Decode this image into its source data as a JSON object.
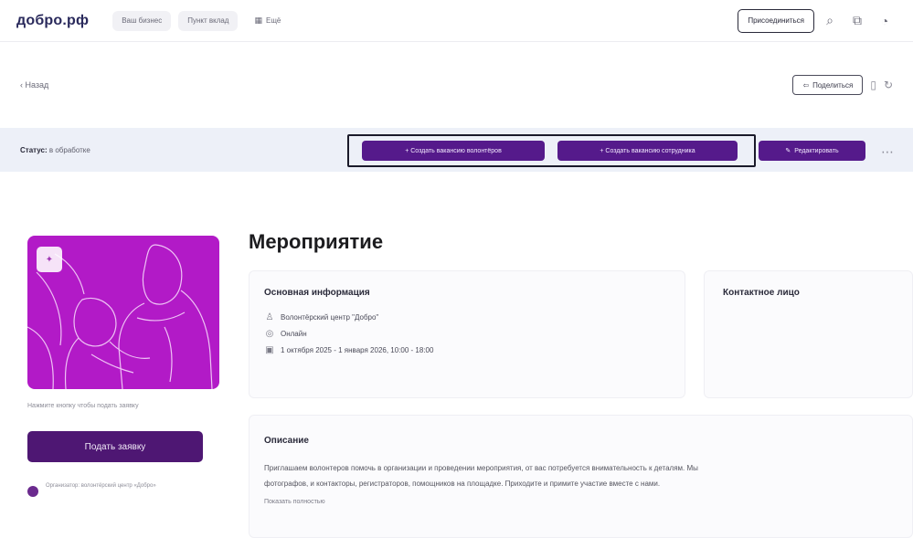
{
  "brand": {
    "logo": "добро.рф",
    "accent": "#551a8b",
    "hero_color": "#b21ac7",
    "band_color": "#edf0f8"
  },
  "topbar": {
    "chips": [
      {
        "label": "Ваш бизнес"
      },
      {
        "label": "Пункт вклад"
      },
      {
        "label": "Ещё"
      }
    ],
    "cta": "Присоединиться",
    "icons": [
      "search-icon",
      "share-icon",
      "bell-icon"
    ]
  },
  "crumb": {
    "back": "‹ Назад",
    "share": "Поделиться"
  },
  "action_band": {
    "status_label": "Статус:",
    "status_value": "в обработке",
    "create_btn_1": "+ Создать вакансию волонтёров",
    "create_btn_2": "+ Создать вакансию сотрудника",
    "edit_btn": "Редактировать"
  },
  "left": {
    "note": "Нажмите кнопку чтобы подать заявку",
    "apply": "Подать заявку",
    "org": "Организатор: волонтёрский центр «Добро»"
  },
  "main": {
    "title": "Мероприятие",
    "info_title": "Основная информация",
    "info": [
      {
        "icon": "organizer-icon",
        "text": "Волонтёрский центр \"Добро\""
      },
      {
        "icon": "location-icon",
        "text": "Онлайн"
      },
      {
        "icon": "calendar-icon",
        "text": "1 октября 2025 - 1 января 2026, 10:00 - 18:00"
      }
    ],
    "contact_title": "Контактное лицо",
    "desc_title": "Описание",
    "desc_lines": [
      "Приглашаем волонтеров помочь в организации и проведении мероприятия, от вас потребуется внимательность к деталям. Мы",
      "фотографов, и контакторы, регистраторов, помощников на площадке. Приходите и примите участие вместе с нами."
    ],
    "show_more": "Показать полностью"
  }
}
